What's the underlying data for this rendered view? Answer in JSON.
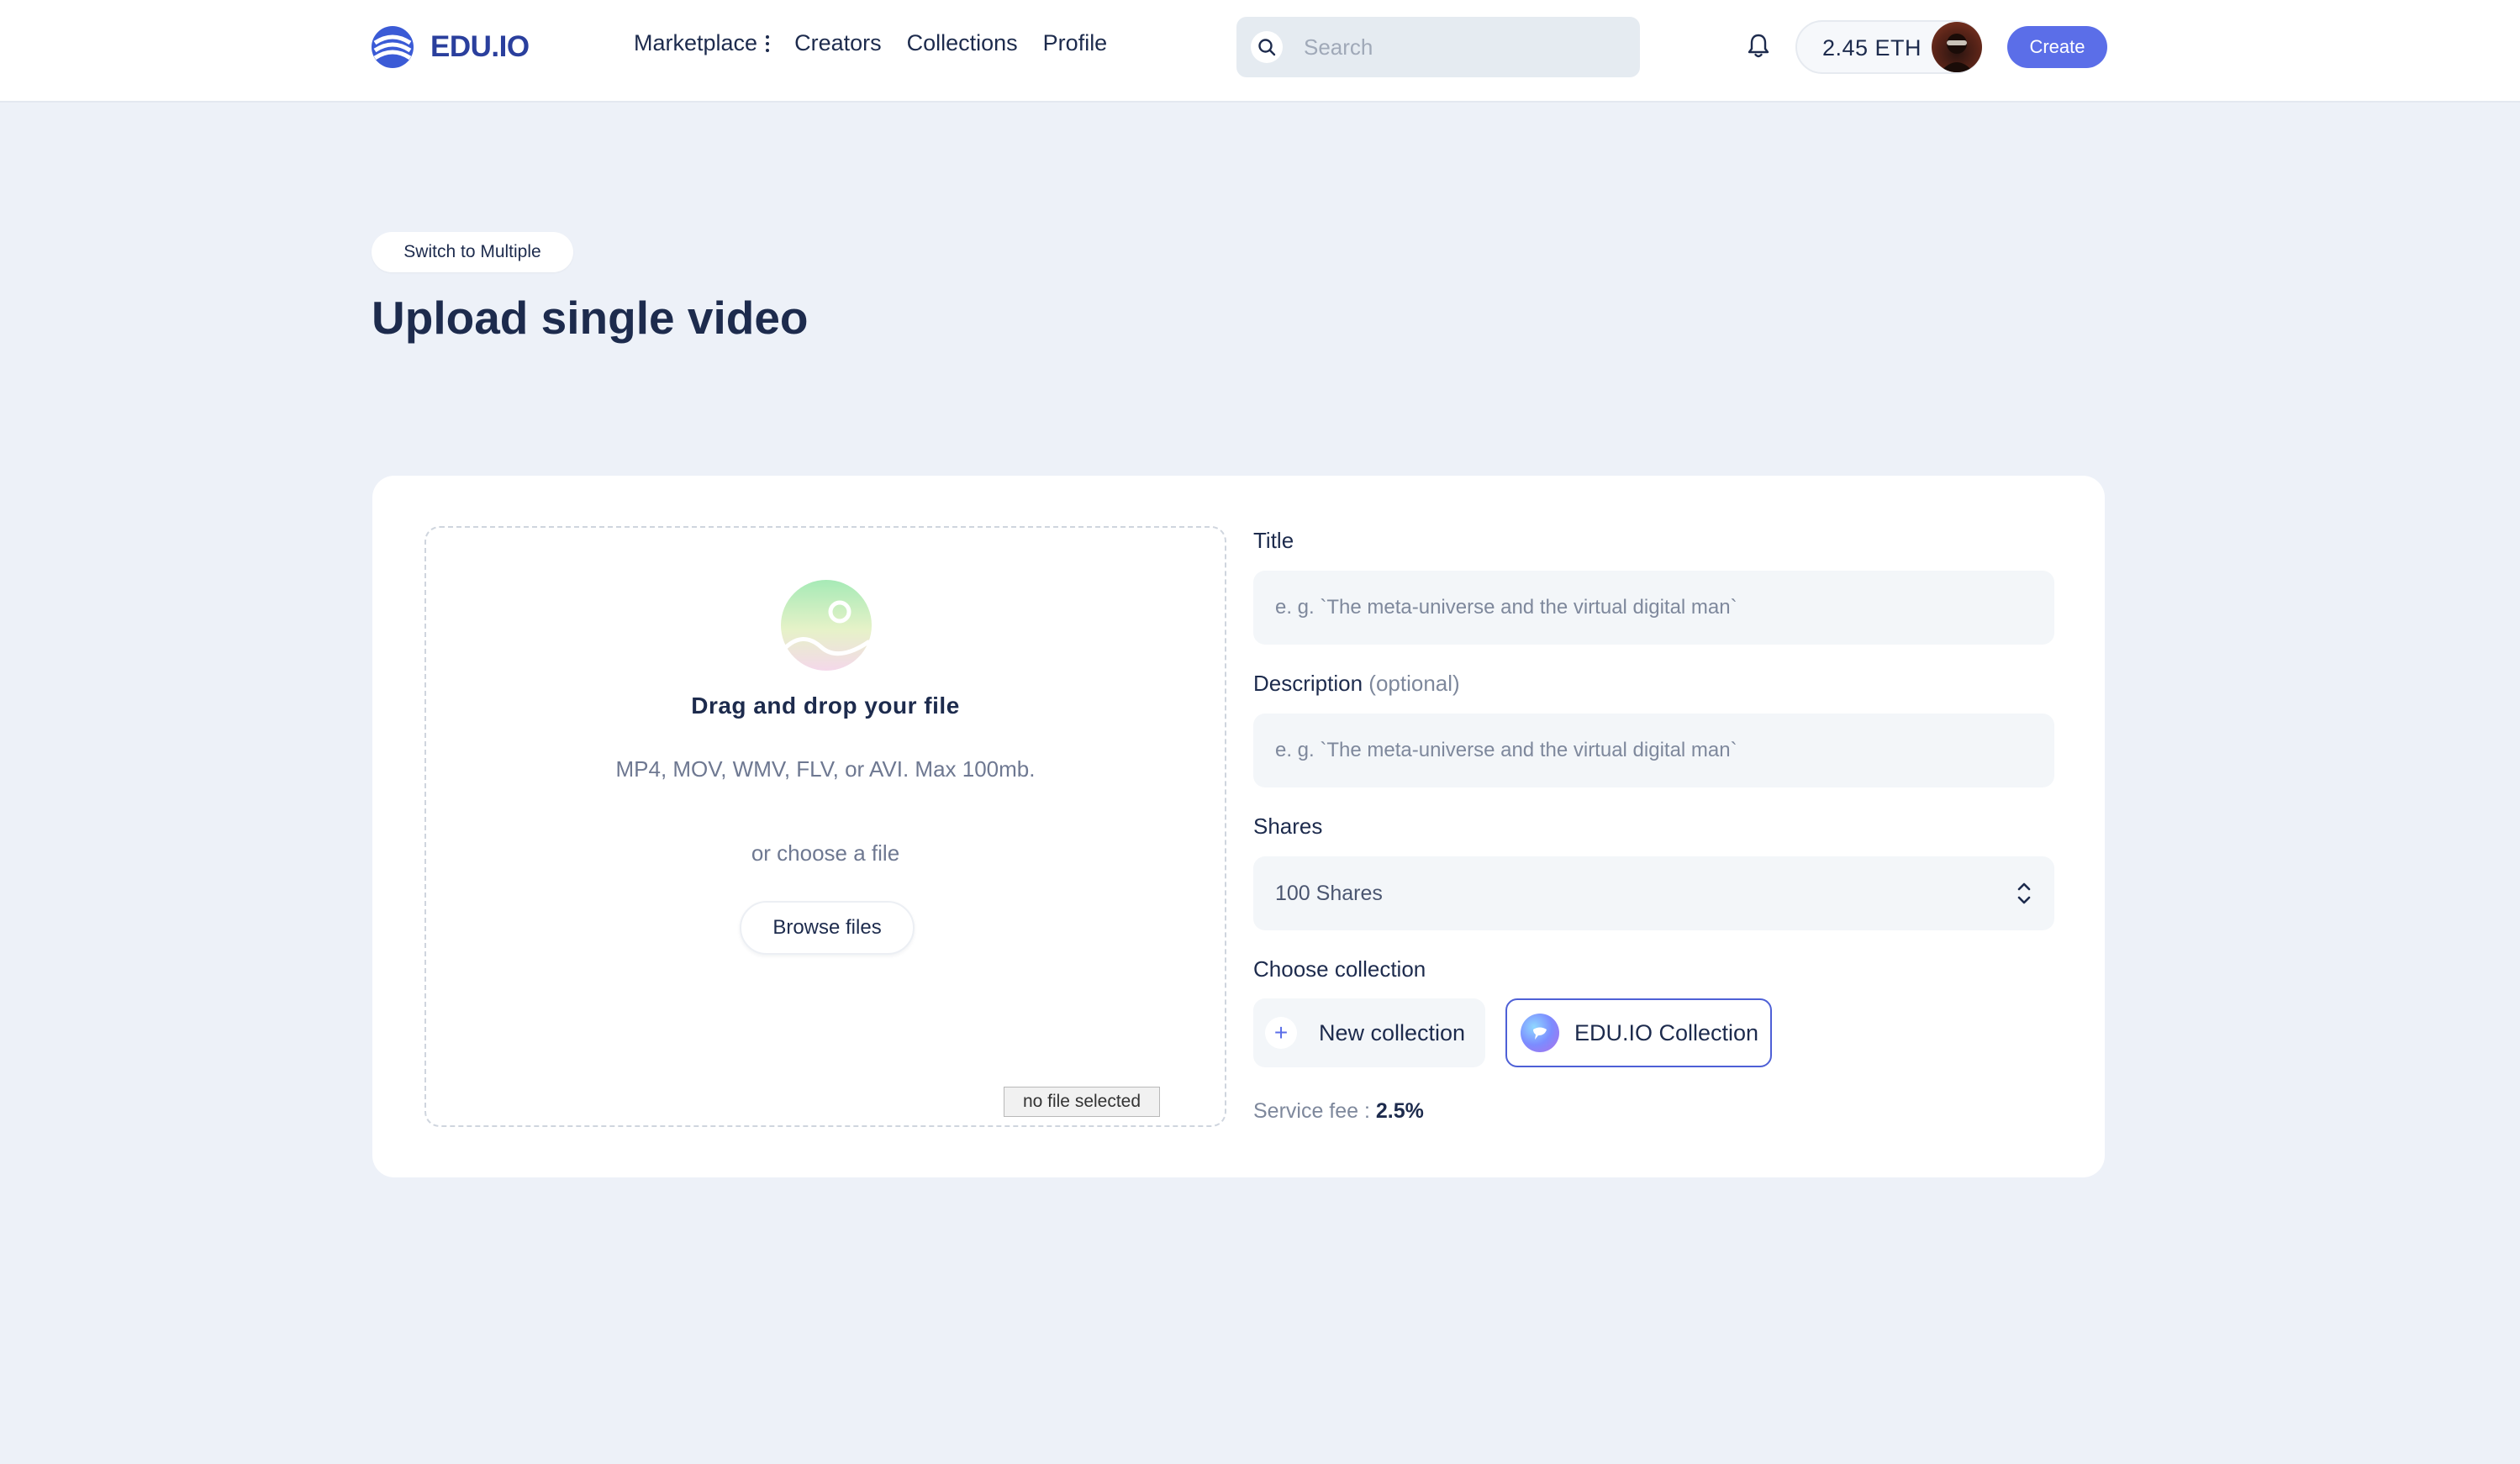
{
  "header": {
    "logo_text": "EDU.IO",
    "nav": [
      {
        "label": "Marketplace"
      },
      {
        "label": "Creators"
      },
      {
        "label": "Collections"
      },
      {
        "label": "Profile"
      }
    ],
    "search": {
      "placeholder": "Search",
      "value": ""
    },
    "wallet_balance": "2.45 ETH",
    "create_label": "Create"
  },
  "page": {
    "switch_label": "Switch to Multiple",
    "title": "Upload single video"
  },
  "upload": {
    "title": "Drag and drop your file",
    "formats": "MP4, MOV, WMV, FLV, or AVI. Max 100mb.",
    "or_text": "or choose a file",
    "browse_label": "Browse files",
    "no_file": "no file selected"
  },
  "form": {
    "title_label": "Title",
    "title_placeholder": "e. g. `The meta-universe and the virtual digital man`",
    "description_label": "Description",
    "description_optional": "(optional)",
    "description_placeholder": "e. g. `The meta-universe and the virtual digital man`",
    "shares_label": "Shares",
    "shares_value": "100 Shares",
    "collection_label": "Choose collection",
    "new_collection": "New collection",
    "selected_collection": "EDU.IO Collection",
    "service_fee_label": "Service fee :",
    "service_fee_value": "2.5%"
  },
  "colors": {
    "accent": "#5b6ee8",
    "brand": "#2a3f9d",
    "background": "#edf1f8"
  },
  "icons": [
    "logo-icon",
    "menu-dots-icon",
    "search-icon",
    "bell-icon",
    "avatar",
    "image-icon",
    "chevron-updown-icon",
    "plus-icon",
    "collection-icon"
  ]
}
